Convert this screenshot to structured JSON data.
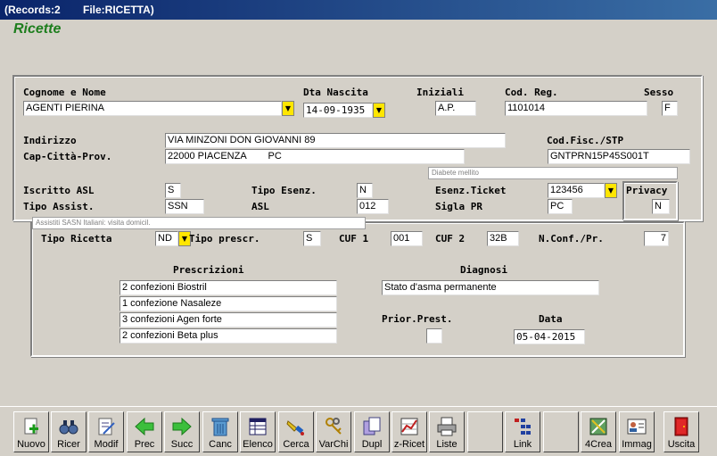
{
  "window": {
    "title_records": "(Records:2",
    "title_file": "File:RICETTA)"
  },
  "form": {
    "title": "Ricette"
  },
  "patient": {
    "lbl_name": "Cognome e Nome",
    "name": "AGENTI PIERINA",
    "lbl_birth": "Dta Nascita",
    "birth": "14-09-1935",
    "lbl_initials": "Iniziali",
    "initials": "A.P.",
    "lbl_code": "Cod. Reg.",
    "code": "1101014",
    "lbl_sex": "Sesso",
    "sex": "F",
    "lbl_address": "Indirizzo",
    "address": "VIA MINZONI DON GIOVANNI 89",
    "lbl_city": "Cap-Città-Prov.",
    "city": "22000 PIACENZA        PC",
    "lbl_fiscal": "Cod.Fisc./STP",
    "fiscal": "GNTPRN15P45S001T",
    "exemption_note": "Diabete mellito",
    "lbl_asl_reg": "Iscritto ASL",
    "asl_reg": "S",
    "lbl_exempt_type": "Tipo Esenz.",
    "exempt_type": "N",
    "lbl_ticket": "Esenz.Ticket",
    "ticket": "123456",
    "lbl_privacy": "Privacy",
    "privacy": "N",
    "lbl_assist": "Tipo Assist.",
    "assist": "SSN",
    "lbl_asl": "ASL",
    "asl": "012",
    "lbl_sigla": "Sigla PR",
    "sigla": "PC",
    "assist_note": "Assistiti SASN Italiani: visita domicil."
  },
  "prescription": {
    "lbl_type": "Tipo Ricetta",
    "type": "ND",
    "lbl_ptype": "Tipo prescr.",
    "ptype": "S",
    "lbl_cuf1": "CUF 1",
    "cuf1": "001",
    "lbl_cuf2": "CUF 2",
    "cuf2": "32B",
    "lbl_nconf": "N.Conf./Pr.",
    "nconf": "7",
    "lbl_prescriptions": "Prescrizioni",
    "items": [
      "2 confezioni Biostril",
      "1 confezione Nasaleze",
      "3 confezioni Agen forte",
      "2 confezioni Beta plus"
    ],
    "lbl_diagnosis": "Diagnosi",
    "diagnosis": "Stato d'asma permanente",
    "lbl_priority": "Prior.Prest.",
    "priority": "",
    "lbl_date": "Data",
    "date": "05-04-2015"
  },
  "toolbar": {
    "nuovo": "Nuovo",
    "ricer": "Ricer",
    "modif": "Modif",
    "prec": "Prec",
    "succ": "Succ",
    "canc": "Canc",
    "elenco": "Elenco",
    "cerca": "Cerca",
    "varchi": "VarChi",
    "dupl": "Dupl",
    "zricet": "z-Ricet",
    "liste": "Liste",
    "link": "Link",
    "crea": "4Crea",
    "immag": "Immag",
    "uscita": "Uscita"
  }
}
